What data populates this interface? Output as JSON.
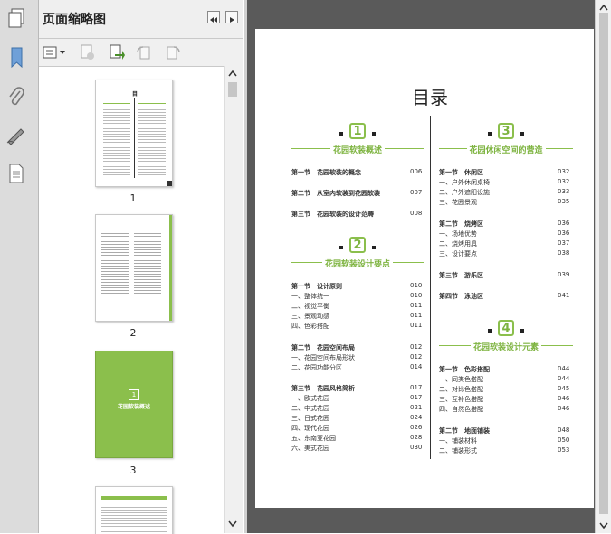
{
  "panel": {
    "title": "页面缩略图",
    "thumbnails": [
      {
        "label": "1"
      },
      {
        "label": "2"
      },
      {
        "label": "3",
        "cover_text": "花园软装概述",
        "cover_num": "1"
      }
    ]
  },
  "colors": {
    "accent": "#8bbf4c",
    "docbg": "#5a5a5a"
  },
  "icons": {
    "pages": "pages-icon",
    "bookmark": "bookmark-icon",
    "attach": "paperclip-icon",
    "sign": "signature-icon",
    "layers": "document-icon"
  },
  "doc": {
    "title": "目录",
    "left": [
      {
        "num": "1",
        "title": "花园软装概述",
        "items": [
          {
            "t": "第一节　花园软装的概念",
            "p": "006",
            "b": true
          },
          {
            "t": "第二节　从室内软装到花园软装",
            "p": "007",
            "b": true
          },
          {
            "t": "第三节　花园软装的设计范畴",
            "p": "008",
            "b": true
          }
        ]
      },
      {
        "num": "2",
        "title": "花园软装设计要点",
        "items": [
          {
            "t": "第一节　设计原则",
            "p": "010",
            "b": true
          },
          {
            "t": "一、整体统一",
            "p": "010"
          },
          {
            "t": "二、视觉平衡",
            "p": "011"
          },
          {
            "t": "三、景观动感",
            "p": "011"
          },
          {
            "t": "四、色彩搭配",
            "p": "011"
          },
          {
            "t": "第二节　花园空间布局",
            "p": "012",
            "b": true
          },
          {
            "t": "一、花园空间布局形状",
            "p": "012"
          },
          {
            "t": "二、花园功能分区",
            "p": "014"
          },
          {
            "t": "第三节　花园风格简析",
            "p": "017",
            "b": true
          },
          {
            "t": "一、欧式花园",
            "p": "017"
          },
          {
            "t": "二、中式花园",
            "p": "021"
          },
          {
            "t": "三、日式花园",
            "p": "024"
          },
          {
            "t": "四、现代花园",
            "p": "026"
          },
          {
            "t": "五、东南亚花园",
            "p": "028"
          },
          {
            "t": "六、美式花园",
            "p": "030"
          }
        ]
      }
    ],
    "right": [
      {
        "num": "3",
        "title": "花园休闲空间的营造",
        "items": [
          {
            "t": "第一节　休闲区",
            "p": "032",
            "b": true
          },
          {
            "t": "一、户外休闲桌椅",
            "p": "032"
          },
          {
            "t": "二、户外遮阳设施",
            "p": "033"
          },
          {
            "t": "三、花园景观",
            "p": "035"
          },
          {
            "t": "第二节　烧烤区",
            "p": "036",
            "b": true
          },
          {
            "t": "一、场地优势",
            "p": "036"
          },
          {
            "t": "二、烧烤用具",
            "p": "037"
          },
          {
            "t": "三、设计要点",
            "p": "038"
          },
          {
            "t": "第三节　游乐区",
            "p": "039",
            "b": true
          },
          {
            "t": "第四节　泳池区",
            "p": "041",
            "b": true
          }
        ]
      },
      {
        "num": "4",
        "title": "花园软装设计元素",
        "items": [
          {
            "t": "第一节　色彩搭配",
            "p": "044",
            "b": true
          },
          {
            "t": "一、同类色搭配",
            "p": "044"
          },
          {
            "t": "二、对比色搭配",
            "p": "045"
          },
          {
            "t": "三、互补色搭配",
            "p": "046"
          },
          {
            "t": "四、自然色搭配",
            "p": "046"
          },
          {
            "t": "第二节　地面铺装",
            "p": "048",
            "b": true
          },
          {
            "t": "一、铺装材料",
            "p": "050"
          },
          {
            "t": "二、铺装形式",
            "p": "053"
          }
        ]
      }
    ]
  }
}
